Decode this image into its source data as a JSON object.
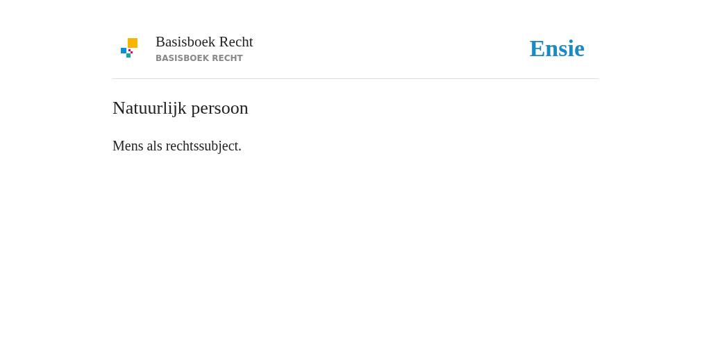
{
  "header": {
    "title": "Basisboek Recht",
    "subtitle": "BASISBOEK RECHT",
    "brand": "Ensie"
  },
  "entry": {
    "term": "Natuurlijk persoon",
    "definition": "Mens als rechtssubject."
  }
}
